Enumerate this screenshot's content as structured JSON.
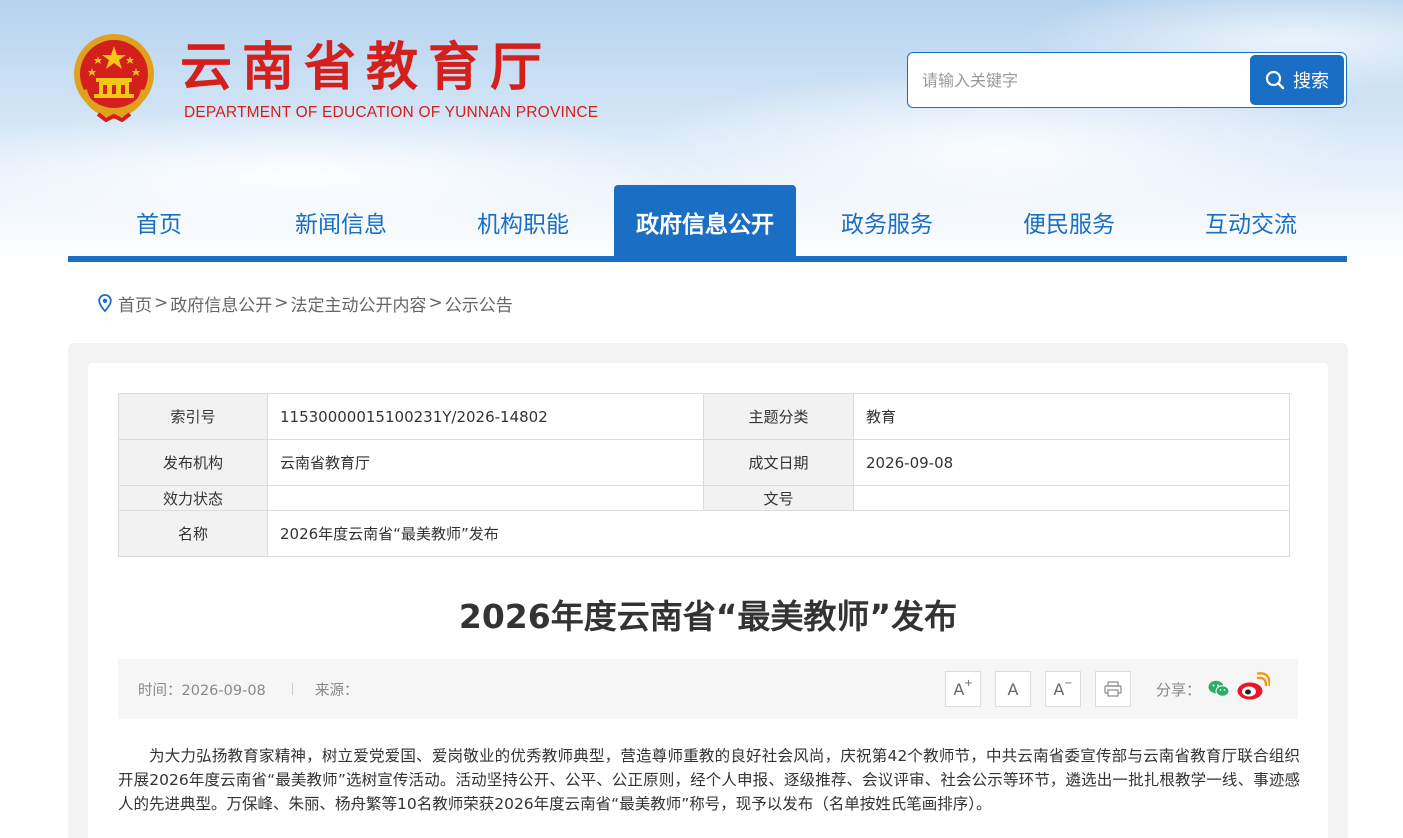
{
  "header": {
    "site_title": "云南省教育厅",
    "site_subtitle": "DEPARTMENT OF EDUCATION OF YUNNAN PROVINCE",
    "emblem_icon": "national-emblem-icon"
  },
  "search": {
    "placeholder": "请输入关键字",
    "button_label": "搜索",
    "icon": "search-icon"
  },
  "nav": {
    "items": [
      {
        "label": "首页"
      },
      {
        "label": "新闻信息"
      },
      {
        "label": "机构职能"
      },
      {
        "label": "政府信息公开"
      },
      {
        "label": "政务服务"
      },
      {
        "label": "便民服务"
      },
      {
        "label": "互动交流"
      }
    ],
    "active_index": 3
  },
  "breadcrumb": {
    "icon": "location-pin-icon",
    "items": [
      "首页",
      "政府信息公开",
      "法定主动公开内容",
      "公示公告"
    ],
    "separator": ">"
  },
  "meta": {
    "index_label": "索引号",
    "index_value": "11530000015100231Y/2026-14802",
    "topic_label": "主题分类",
    "topic_value": "教育",
    "publisher_label": "发布机构",
    "publisher_value": "云南省教育厅",
    "date_label": "成文日期",
    "date_value": "2026-09-08",
    "validity_label": "效力状态",
    "validity_value": "",
    "docno_label": "文号",
    "docno_value": "",
    "name_label": "名称",
    "name_value": "2026年度云南省“最美教师”发布"
  },
  "article": {
    "title": "2026年度云南省“最美教师”发布",
    "time": "时间：2026-09-08",
    "source": "来源：",
    "tools": {
      "font_larger": "A",
      "font_normal": "A",
      "font_smaller": "A",
      "plus_mark": "+",
      "minus_mark": "−"
    },
    "share_label": "分享：",
    "paragraph": "为大力弘扬教育家精神，树立爱党爱国、爱岗敬业的优秀教师典型，营造尊师重教的良好社会风尚，庆祝第42个教师节，中共云南省委宣传部与云南省教育厅联合组织开展2026年度云南省“最美教师”选树宣传活动。活动坚持公开、公平、公正原则，经个人申报、逐级推荐、会议评审、社会公示等环节，遴选出一批扎根教学一线、事迹感人的先进典型。万保峰、朱丽、杨舟繁等10名教师荣获2026年度云南省“最美教师”称号，现予以发布（名单按姓氏笔画排序）。"
  },
  "colors": {
    "brand_blue": "#1a6fc4",
    "title_red": "#d4201c",
    "wechat_green": "#2aae67",
    "weibo_red": "#e6162d"
  }
}
